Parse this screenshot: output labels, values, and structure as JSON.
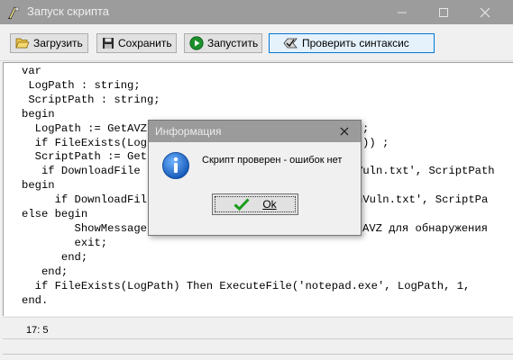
{
  "window": {
    "title": "Запуск скрипта"
  },
  "toolbar": {
    "load_label": "Загрузить",
    "save_label": "Сохранить",
    "run_label": "Запустить",
    "check_label": "Проверить синтаксис"
  },
  "editor": {
    "lines": [
      "var",
      " LogPath : string;",
      " ScriptPath : string;",
      "begin",
      "  LogPath := GetAVZ",
      "  if FileExists(Log",
      "  ScriptPath := Get",
      "   if DownloadFile",
      "begin",
      "     if DownloadFil",
      "else begin",
      "        ShowMessage",
      "        exit;",
      "      end;",
      "   end;",
      "  if FileExists(LogPath) Then ExecuteFile('notepad.exe', LogPath, 1,",
      "end."
    ],
    "right_fragments": [
      {
        "line": 4,
        "text": ";"
      },
      {
        "line": 5,
        "text": ")) ;"
      },
      {
        "line": 7,
        "text": "Vuln.txt', ScriptPath"
      },
      {
        "line": 9,
        "text": "nVuln.txt', ScriptPa"
      },
      {
        "line": 11,
        "text": "AVZ для обнаружения"
      }
    ],
    "cursor_position": "17: 5"
  },
  "dialog": {
    "title": "Информация",
    "message": "Скрипт проверен - ошибок нет",
    "ok_label": "Ok"
  },
  "colors": {
    "titlebar": "#9c9c9c",
    "function_name": "#5a5aa8",
    "string_literal": "#000080",
    "check_mark": "#1a9c1a",
    "info_icon": "#1f6fd0"
  }
}
